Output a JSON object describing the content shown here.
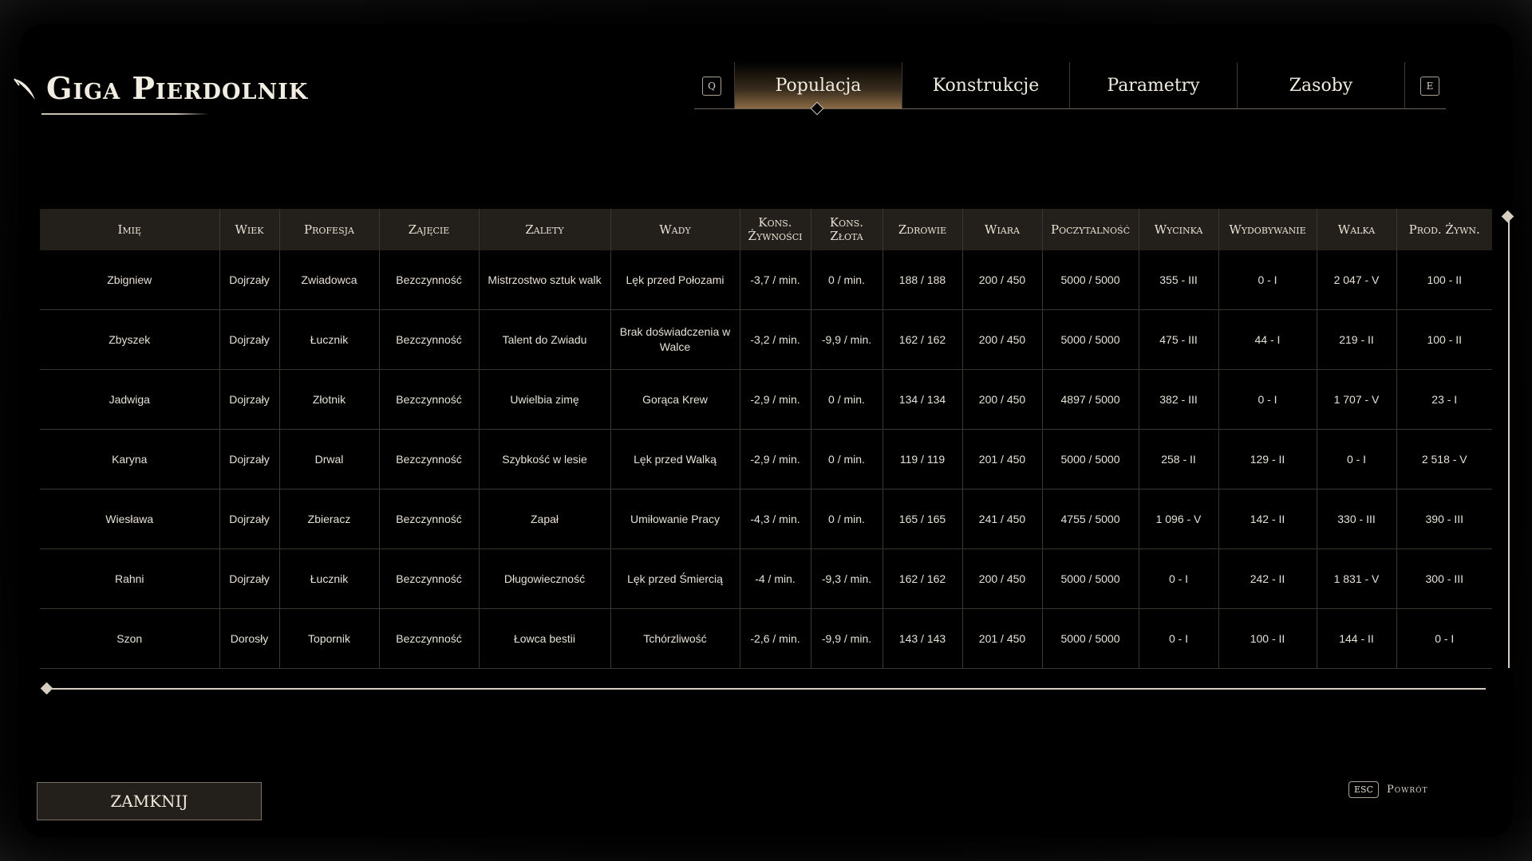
{
  "title": "Giga Pierdolnik",
  "tabs": {
    "prev_key": "Q",
    "next_key": "E",
    "items": [
      "Populacja",
      "Konstrukcje",
      "Parametry",
      "Zasoby"
    ],
    "active": "Populacja"
  },
  "table": {
    "headers": [
      "Imię",
      "Wiek",
      "Profesja",
      "Zajęcie",
      "Zalety",
      "Wady",
      "Kons. Żywności",
      "Kons. Złota",
      "Zdrowie",
      "Wiara",
      "Poczytalność",
      "Wycinka",
      "Wydobywanie",
      "Walka",
      "Prod. Żywn."
    ],
    "rows": [
      [
        "Zbigniew",
        "Dojrzały",
        "Zwiadowca",
        "Bezczynność",
        "Mistrzostwo sztuk walk",
        "Lęk przed Połozami",
        "-3,7 / min.",
        "0 / min.",
        "188 / 188",
        "200 / 450",
        "5000 / 5000",
        "355 - III",
        "0 - I",
        "2 047 - V",
        "100 - II"
      ],
      [
        "Zbyszek",
        "Dojrzały",
        "Łucznik",
        "Bezczynność",
        "Talent do Zwiadu",
        "Brak doświadczenia w Walce",
        "-3,2 / min.",
        "-9,9 / min.",
        "162 / 162",
        "200 / 450",
        "5000 / 5000",
        "475 - III",
        "44 - I",
        "219 - II",
        "100 - II"
      ],
      [
        "Jadwiga",
        "Dojrzały",
        "Złotnik",
        "Bezczynność",
        "Uwielbia zimę",
        "Gorąca Krew",
        "-2,9 / min.",
        "0 / min.",
        "134 / 134",
        "200 / 450",
        "4897 / 5000",
        "382 - III",
        "0 - I",
        "1 707 - V",
        "23 - I"
      ],
      [
        "Karyna",
        "Dojrzały",
        "Drwal",
        "Bezczynność",
        "Szybkość w lesie",
        "Lęk przed Walką",
        "-2,9 / min.",
        "0 / min.",
        "119 / 119",
        "201 / 450",
        "5000 / 5000",
        "258 - II",
        "129 - II",
        "0 - I",
        "2 518 - V"
      ],
      [
        "Wiesława",
        "Dojrzały",
        "Zbieracz",
        "Bezczynność",
        "Zapał",
        "Umiłowanie Pracy",
        "-4,3 / min.",
        "0 / min.",
        "165 / 165",
        "241 / 450",
        "4755 / 5000",
        "1 096 - V",
        "142 - II",
        "330 - III",
        "390 - III"
      ],
      [
        "Rahni",
        "Dojrzały",
        "Łucznik",
        "Bezczynność",
        "Długowieczność",
        "Lęk przed Śmiercią",
        "-4 / min.",
        "-9,3 / min.",
        "162 / 162",
        "200 / 450",
        "5000 / 5000",
        "0 - I",
        "242 - II",
        "1 831 - V",
        "300 - III"
      ],
      [
        "Szon",
        "Dorosły",
        "Topornik",
        "Bezczynność",
        "Łowca bestii",
        "Tchórzliwość",
        "-2,6 / min.",
        "-9,9 / min.",
        "143 / 143",
        "201 / 450",
        "5000 / 5000",
        "0 - I",
        "100 - II",
        "144 - II",
        "0 - I"
      ]
    ]
  },
  "footer": {
    "close_label": "ZAMKNIJ",
    "back_key": "ESC",
    "back_label": "Powrót"
  }
}
